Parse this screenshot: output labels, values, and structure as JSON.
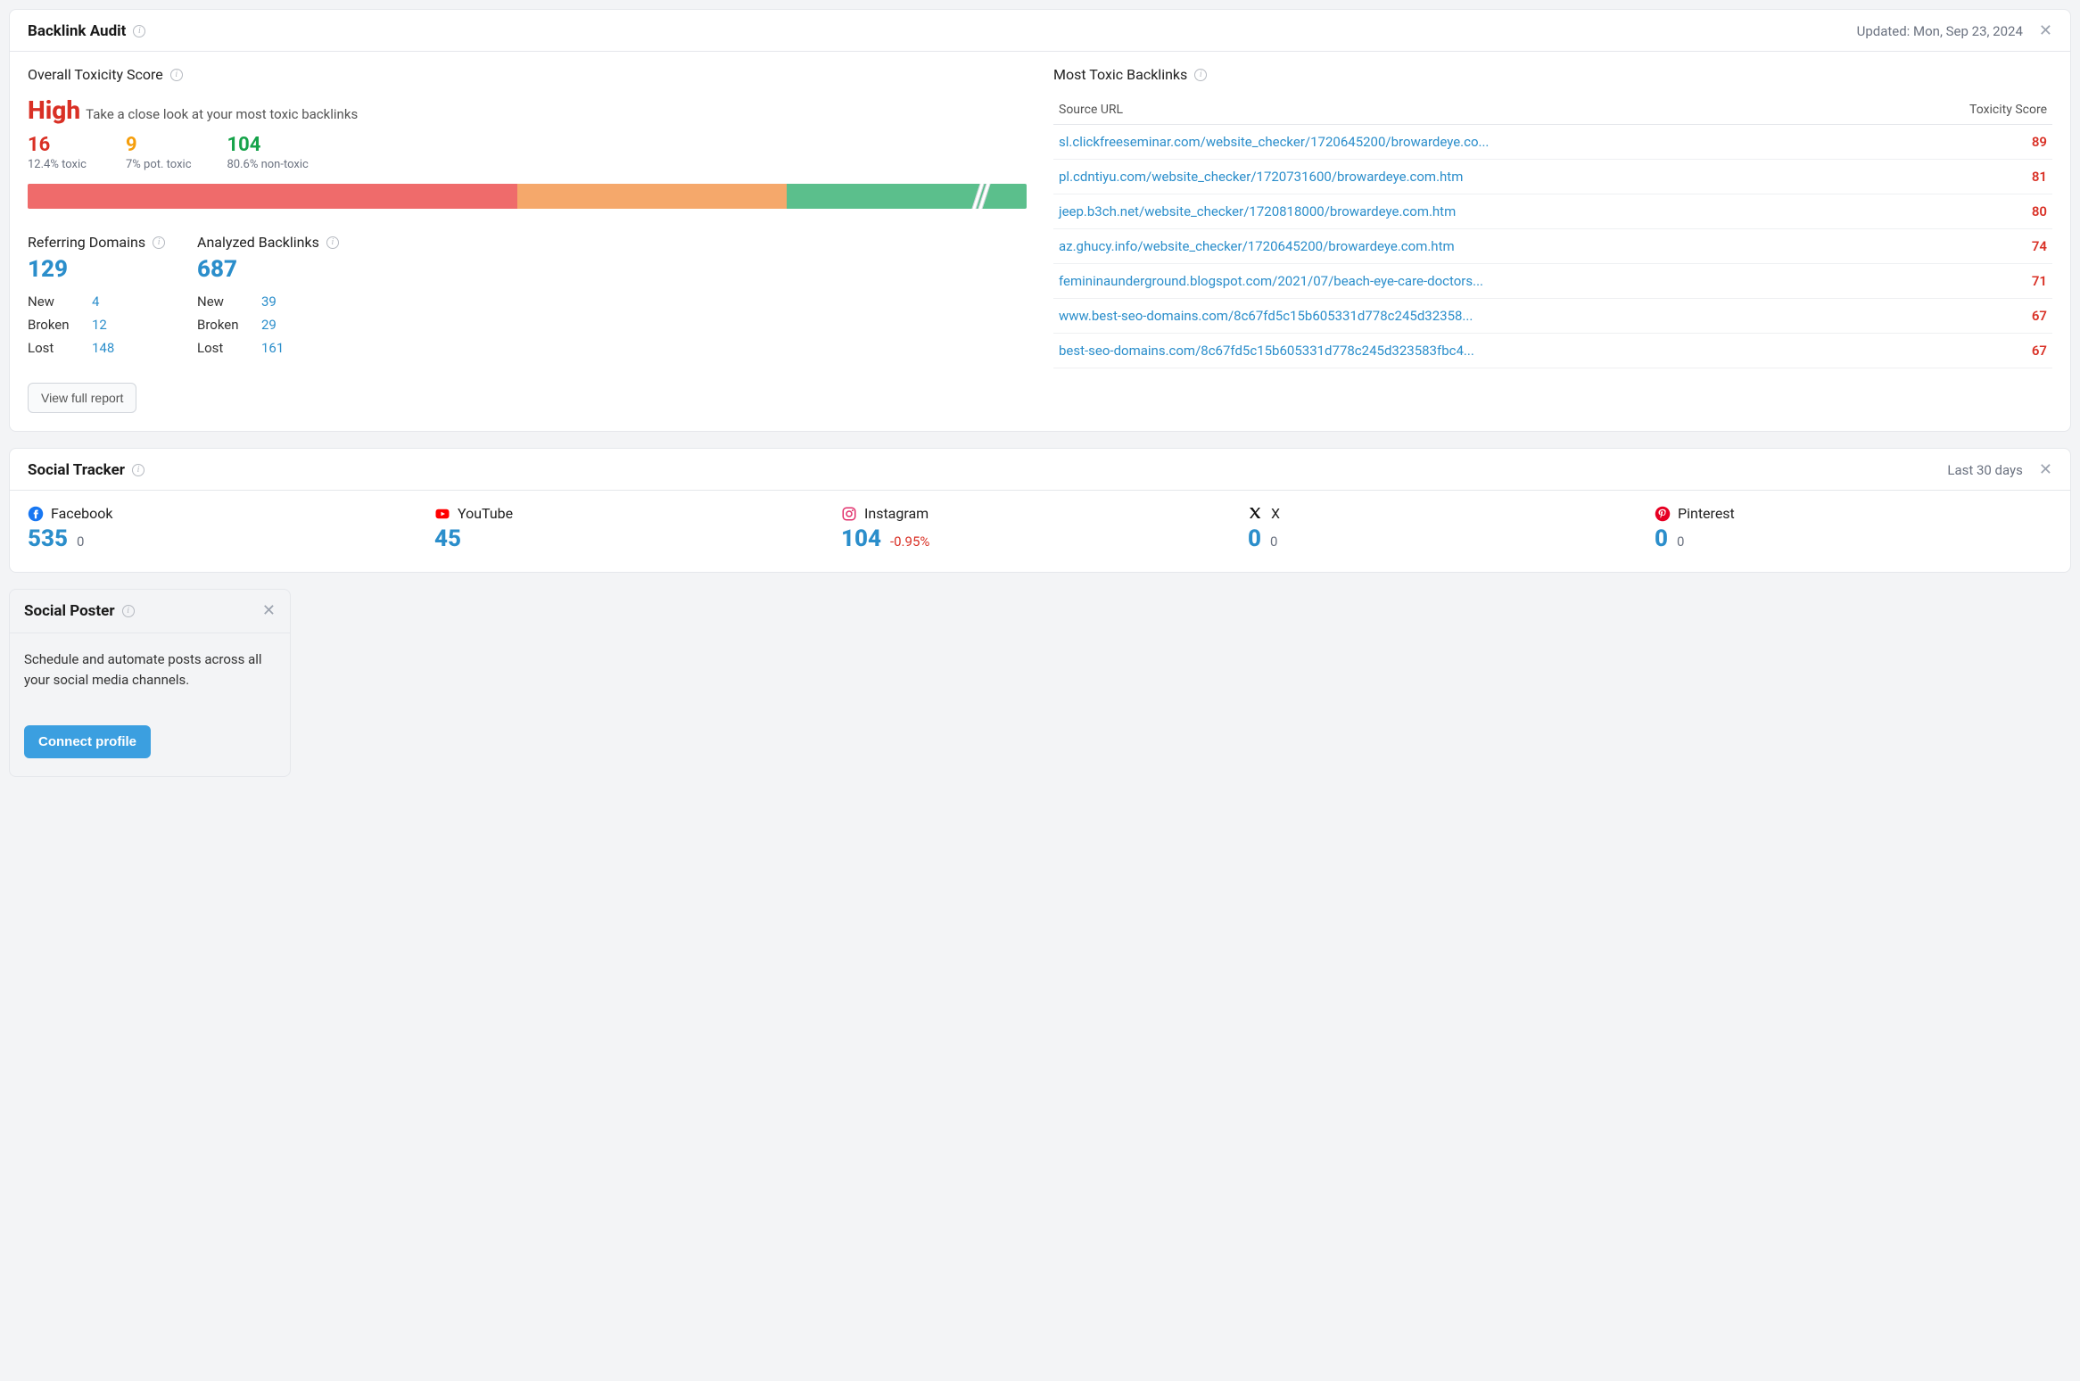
{
  "backlink_audit": {
    "title": "Backlink Audit",
    "updated": "Updated: Mon, Sep 23, 2024",
    "toxicity": {
      "label": "Overall Toxicity Score",
      "level": "High",
      "subtitle": "Take a close look at your most toxic backlinks",
      "toxic_count": "16",
      "toxic_pct": "12.4% toxic",
      "pot_toxic_count": "9",
      "pot_toxic_pct": "7% pot. toxic",
      "non_toxic_count": "104",
      "non_toxic_pct": "80.6% non-toxic"
    },
    "referring_domains": {
      "label": "Referring Domains",
      "total": "129",
      "rows": [
        {
          "label": "New",
          "value": "4"
        },
        {
          "label": "Broken",
          "value": "12"
        },
        {
          "label": "Lost",
          "value": "148"
        }
      ]
    },
    "analyzed_backlinks": {
      "label": "Analyzed Backlinks",
      "total": "687",
      "rows": [
        {
          "label": "New",
          "value": "39"
        },
        {
          "label": "Broken",
          "value": "29"
        },
        {
          "label": "Lost",
          "value": "161"
        }
      ]
    },
    "view_report": "View full report",
    "most_toxic": {
      "label": "Most Toxic Backlinks",
      "col_url": "Source URL",
      "col_score": "Toxicity Score",
      "rows": [
        {
          "url": "sl.clickfreeseminar.com/website_checker/1720645200/browardeye.co...",
          "score": "89"
        },
        {
          "url": "pl.cdntiyu.com/website_checker/1720731600/browardeye.com.htm",
          "score": "81"
        },
        {
          "url": "jeep.b3ch.net/website_checker/1720818000/browardeye.com.htm",
          "score": "80"
        },
        {
          "url": "az.ghucy.info/website_checker/1720645200/browardeye.com.htm",
          "score": "74"
        },
        {
          "url": "femininaunderground.blogspot.com/2021/07/beach-eye-care-doctors...",
          "score": "71"
        },
        {
          "url": "www.best-seo-domains.com/8c67fd5c15b605331d778c245d32358...",
          "score": "67"
        },
        {
          "url": "best-seo-domains.com/8c67fd5c15b605331d778c245d323583fbc4...",
          "score": "67"
        }
      ]
    }
  },
  "social_tracker": {
    "title": "Social Tracker",
    "range": "Last 30 days",
    "items": [
      {
        "name": "Facebook",
        "value": "535",
        "delta": "0",
        "delta_neg": false
      },
      {
        "name": "YouTube",
        "value": "45",
        "delta": "",
        "delta_neg": false
      },
      {
        "name": "Instagram",
        "value": "104",
        "delta": "-0.95%",
        "delta_neg": true
      },
      {
        "name": "X",
        "value": "0",
        "delta": "0",
        "delta_neg": false
      },
      {
        "name": "Pinterest",
        "value": "0",
        "delta": "0",
        "delta_neg": false
      }
    ]
  },
  "social_poster": {
    "title": "Social Poster",
    "text": "Schedule and automate posts across all your social media channels.",
    "cta": "Connect profile"
  },
  "chart_data": {
    "type": "bar",
    "title": "Overall Toxicity Score breakdown",
    "categories": [
      "toxic",
      "pot. toxic",
      "non-toxic"
    ],
    "values": [
      16,
      9,
      104
    ],
    "percentages": [
      12.4,
      7.0,
      80.6
    ],
    "colors": [
      "#ef6b6b",
      "#f5a86b",
      "#5bbf8c"
    ],
    "xlabel": "",
    "ylabel": "",
    "ylim": [
      0,
      129
    ]
  }
}
